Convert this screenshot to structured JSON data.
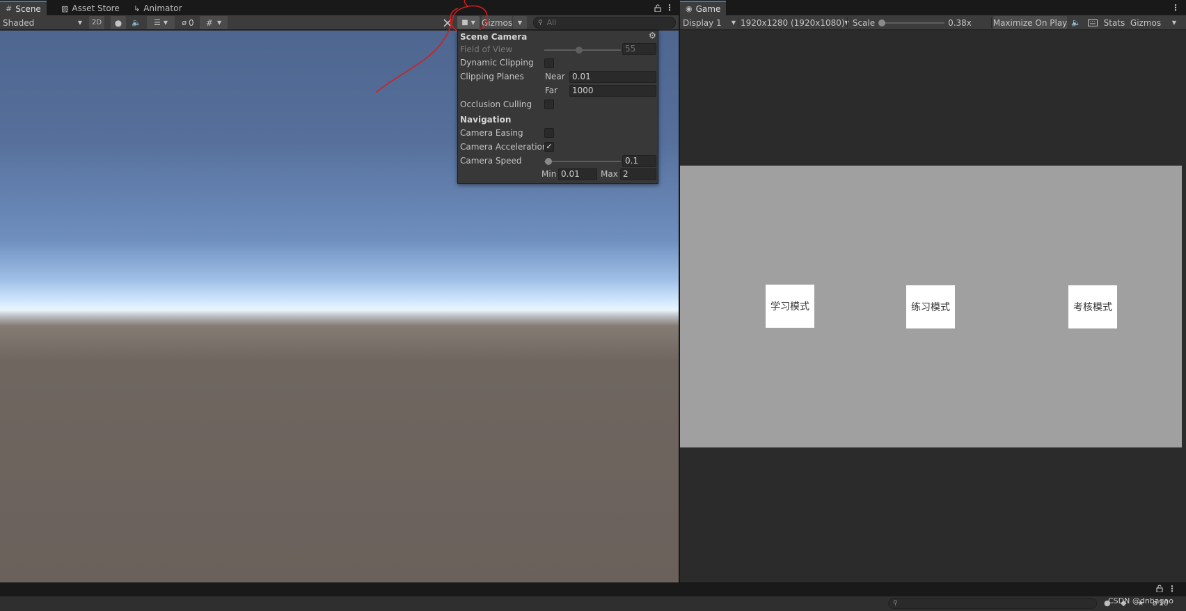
{
  "scene_window": {
    "tabs": [
      {
        "label": "Scene",
        "icon": "grid-icon"
      },
      {
        "label": "Asset Store",
        "icon": "store-bag-icon"
      },
      {
        "label": "Animator",
        "icon": "animator-icon"
      }
    ],
    "toolbar": {
      "draw_mode": "Shaded",
      "toggle_2d": "2D",
      "hidden_count": "0",
      "gizmos_label": "Gizmos",
      "search_placeholder": "All"
    }
  },
  "scene_camera_popup": {
    "title": "Scene Camera",
    "field_of_view": {
      "label": "Field of View",
      "value": "55",
      "fraction": 0.45
    },
    "dynamic_clipping": {
      "label": "Dynamic Clipping",
      "checked": false
    },
    "clipping_planes": {
      "label": "Clipping Planes",
      "near_label": "Near",
      "near_value": "0.01",
      "far_label": "Far",
      "far_value": "1000"
    },
    "occlusion_culling": {
      "label": "Occlusion Culling",
      "checked": false
    },
    "navigation_header": "Navigation",
    "camera_easing": {
      "label": "Camera Easing",
      "checked": false
    },
    "camera_acceleration": {
      "label": "Camera Acceleration",
      "checked": true,
      "checkmark": "✓"
    },
    "camera_speed": {
      "label": "Camera Speed",
      "value": "0.1",
      "fraction": 0.05,
      "min_label": "Min",
      "min_value": "0.01",
      "max_label": "Max",
      "max_value": "2"
    }
  },
  "game_window": {
    "tab_label": "Game",
    "display": "Display 1",
    "resolution": "1920x1280 (1920x1080)",
    "scale_label": "Scale",
    "scale_value": "0.38x",
    "maximize_label": "Maximize On Play",
    "stats_label": "Stats",
    "gizmos_label": "Gizmos",
    "buttons": [
      "学习模式",
      "练习模式",
      "考核模式"
    ]
  },
  "status_bar": {
    "layer_count": "10",
    "watermark": "CSDN @dnbagao"
  },
  "colors": {
    "annotation_red": "#d21e1e",
    "accent_blue": "#3a79bb"
  }
}
